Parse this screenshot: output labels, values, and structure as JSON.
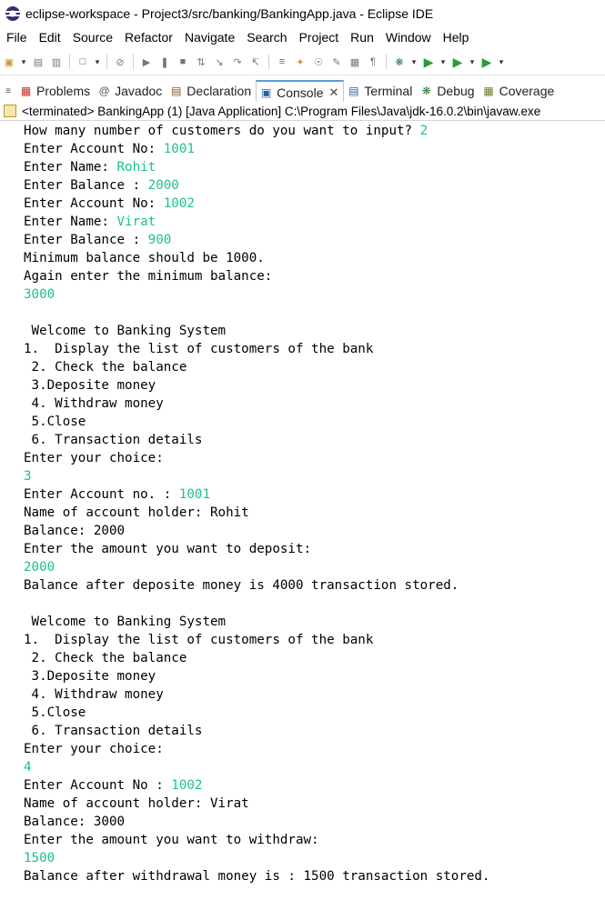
{
  "window": {
    "title": "eclipse-workspace - Project3/src/banking/BankingApp.java - Eclipse IDE"
  },
  "menu": [
    "File",
    "Edit",
    "Source",
    "Refactor",
    "Navigate",
    "Search",
    "Project",
    "Run",
    "Window",
    "Help"
  ],
  "tabs": [
    {
      "label": "Problems",
      "icon": "problems-icon",
      "active": false
    },
    {
      "label": "Javadoc",
      "icon": "javadoc-icon",
      "active": false
    },
    {
      "label": "Declaration",
      "icon": "declaration-icon",
      "active": false
    },
    {
      "label": "Console",
      "icon": "console-icon",
      "active": true
    },
    {
      "label": "Terminal",
      "icon": "terminal-icon",
      "active": false
    },
    {
      "label": "Debug",
      "icon": "debug-icon",
      "active": false
    },
    {
      "label": "Coverage",
      "icon": "coverage-icon",
      "active": false
    }
  ],
  "console_status": "<terminated> BankingApp (1) [Java Application] C:\\Program Files\\Java\\jdk-16.0.2\\bin\\javaw.exe",
  "colors": {
    "input_text": "#1fbf8e",
    "active_tab_accent": "#5b9bd5"
  },
  "console_lines": [
    [
      {
        "t": "How many number of customers do you want to input? "
      },
      {
        "t": "2",
        "in": true
      }
    ],
    [
      {
        "t": "Enter Account No: "
      },
      {
        "t": "1001",
        "in": true
      }
    ],
    [
      {
        "t": "Enter Name: "
      },
      {
        "t": "Rohit",
        "in": true
      }
    ],
    [
      {
        "t": "Enter Balance : "
      },
      {
        "t": "2000",
        "in": true
      }
    ],
    [
      {
        "t": "Enter Account No: "
      },
      {
        "t": "1002",
        "in": true
      }
    ],
    [
      {
        "t": "Enter Name: "
      },
      {
        "t": "Virat",
        "in": true
      }
    ],
    [
      {
        "t": "Enter Balance : "
      },
      {
        "t": "900",
        "in": true
      }
    ],
    [
      {
        "t": "Minimum balance should be 1000."
      }
    ],
    [
      {
        "t": "Again enter the minimum balance:"
      }
    ],
    [
      {
        "t": "3000",
        "in": true
      }
    ],
    [
      {
        "t": ""
      }
    ],
    [
      {
        "t": " Welcome to Banking System"
      }
    ],
    [
      {
        "t": "1.  Display the list of customers of the bank"
      }
    ],
    [
      {
        "t": " 2. Check the balance"
      }
    ],
    [
      {
        "t": " 3.Deposite money"
      }
    ],
    [
      {
        "t": " 4. Withdraw money"
      }
    ],
    [
      {
        "t": " 5.Close"
      }
    ],
    [
      {
        "t": " 6. Transaction details"
      }
    ],
    [
      {
        "t": "Enter your choice:"
      }
    ],
    [
      {
        "t": "3",
        "in": true
      }
    ],
    [
      {
        "t": "Enter Account no. : "
      },
      {
        "t": "1001",
        "in": true
      }
    ],
    [
      {
        "t": "Name of account holder: Rohit"
      }
    ],
    [
      {
        "t": "Balance: 2000"
      }
    ],
    [
      {
        "t": "Enter the amount you want to deposit:"
      }
    ],
    [
      {
        "t": "2000",
        "in": true
      }
    ],
    [
      {
        "t": "Balance after deposite money is 4000 transaction stored."
      }
    ],
    [
      {
        "t": ""
      }
    ],
    [
      {
        "t": " Welcome to Banking System"
      }
    ],
    [
      {
        "t": "1.  Display the list of customers of the bank"
      }
    ],
    [
      {
        "t": " 2. Check the balance"
      }
    ],
    [
      {
        "t": " 3.Deposite money"
      }
    ],
    [
      {
        "t": " 4. Withdraw money"
      }
    ],
    [
      {
        "t": " 5.Close"
      }
    ],
    [
      {
        "t": " 6. Transaction details"
      }
    ],
    [
      {
        "t": "Enter your choice:"
      }
    ],
    [
      {
        "t": "4",
        "in": true
      }
    ],
    [
      {
        "t": "Enter Account No : "
      },
      {
        "t": "1002",
        "in": true
      }
    ],
    [
      {
        "t": "Name of account holder: Virat"
      }
    ],
    [
      {
        "t": "Balance: 3000"
      }
    ],
    [
      {
        "t": "Enter the amount you want to withdraw:"
      }
    ],
    [
      {
        "t": "1500",
        "in": true
      }
    ],
    [
      {
        "t": "Balance after withdrawal money is : 1500 transaction stored."
      }
    ]
  ]
}
